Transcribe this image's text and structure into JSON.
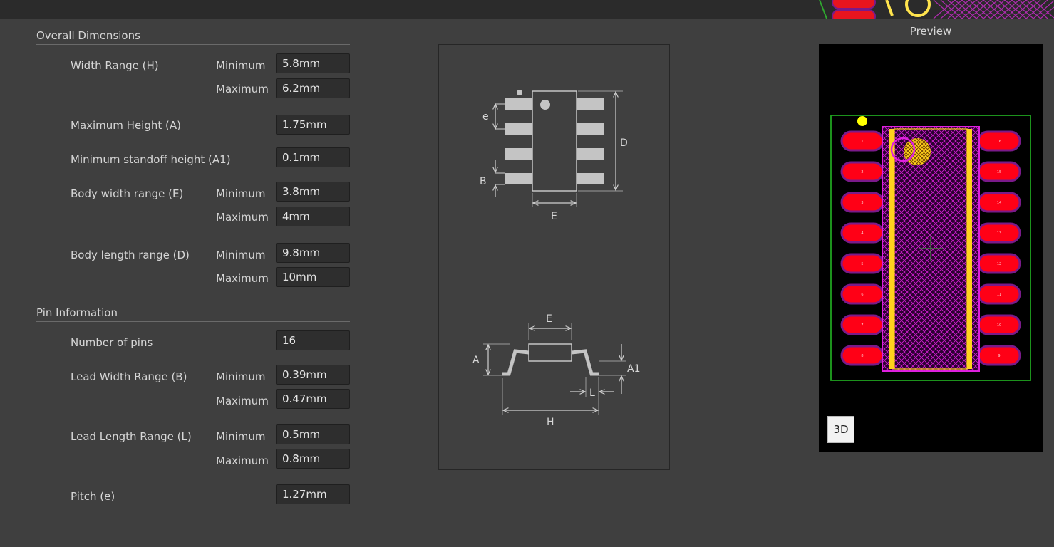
{
  "sections": {
    "overall": "Overall Dimensions",
    "pins": "Pin Information"
  },
  "sub": {
    "min": "Minimum",
    "max": "Maximum"
  },
  "fields": {
    "width_range": {
      "label": "Width Range (H)",
      "min": "5.8mm",
      "max": "6.2mm"
    },
    "max_height": {
      "label": "Maximum Height (A)",
      "value": "1.75mm"
    },
    "min_standoff": {
      "label": "Minimum standoff height (A1)",
      "value": "0.1mm"
    },
    "body_width": {
      "label": "Body width range (E)",
      "min": "3.8mm",
      "max": "4mm"
    },
    "body_length": {
      "label": "Body length range (D)",
      "min": "9.8mm",
      "max": "10mm"
    },
    "num_pins": {
      "label": "Number of pins",
      "value": "16"
    },
    "lead_width": {
      "label": "Lead Width Range (B)",
      "min": "0.39mm",
      "max": "0.47mm"
    },
    "lead_length": {
      "label": "Lead Length Range (L)",
      "min": "0.5mm",
      "max": "0.8mm"
    },
    "pitch": {
      "label": "Pitch (e)",
      "value": "1.27mm"
    }
  },
  "diagram": {
    "top": {
      "e": "e",
      "b": "B",
      "d": "D",
      "e_body": "E"
    },
    "side": {
      "e_body": "E",
      "a": "A",
      "a1": "A1",
      "l": "L",
      "h": "H"
    }
  },
  "preview": {
    "title": "Preview",
    "button_3d": "3D",
    "pin_labels_left": [
      "1",
      "2",
      "3",
      "4",
      "5",
      "6",
      "7",
      "8"
    ],
    "pin_labels_right": [
      "16",
      "15",
      "14",
      "13",
      "12",
      "11",
      "10",
      "9"
    ]
  },
  "colors": {
    "background": "#3f3f3f",
    "field_bg": "#2e2e2e",
    "pad": "#ff0016",
    "pad_outline": "#7a1a8a",
    "courtyard": "#1fa31f",
    "silkscreen": "#ffe44d",
    "outline_magenta": "#e020e0"
  }
}
